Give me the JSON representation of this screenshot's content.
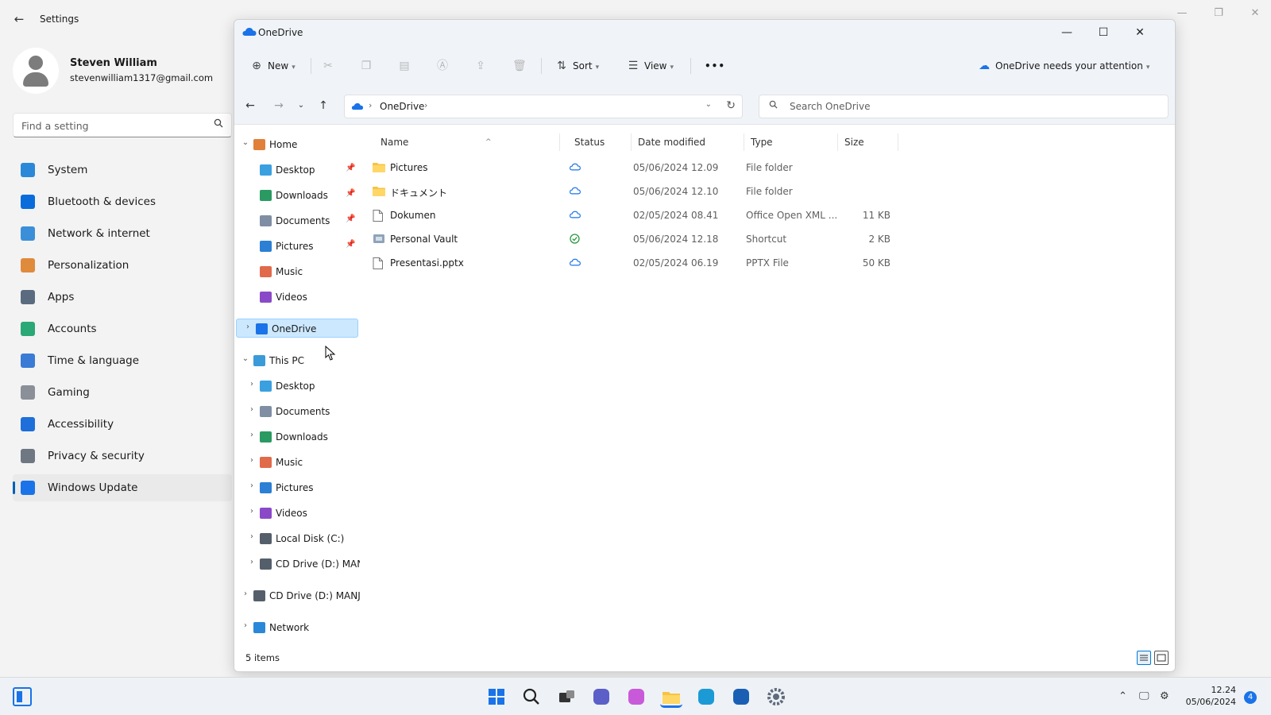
{
  "settings": {
    "title": "Settings",
    "back_glyph": "←",
    "profile": {
      "name": "Steven William",
      "email": "stevenwilliam1317@gmail.com"
    },
    "search_placeholder": "Find a setting",
    "nav": [
      {
        "label": "System",
        "icon": "monitor-icon",
        "color": "#2b88d8"
      },
      {
        "label": "Bluetooth & devices",
        "icon": "bluetooth-icon",
        "color": "#0a6cdb"
      },
      {
        "label": "Network & internet",
        "icon": "wifi-icon",
        "color": "#3b8fd9"
      },
      {
        "label": "Personalization",
        "icon": "brush-icon",
        "color": "#e08a3c"
      },
      {
        "label": "Apps",
        "icon": "apps-icon",
        "color": "#5b6b7f"
      },
      {
        "label": "Accounts",
        "icon": "person-icon",
        "color": "#2aa876"
      },
      {
        "label": "Time & language",
        "icon": "globe-clock-icon",
        "color": "#3a7bd5"
      },
      {
        "label": "Gaming",
        "icon": "controller-icon",
        "color": "#8a8f98"
      },
      {
        "label": "Accessibility",
        "icon": "accessibility-icon",
        "color": "#1e6fd9"
      },
      {
        "label": "Privacy & security",
        "icon": "shield-icon",
        "color": "#6f7782"
      },
      {
        "label": "Windows Update",
        "icon": "sync-icon",
        "color": "#1a73e8"
      }
    ]
  },
  "explorer": {
    "title": "OneDrive",
    "toolbar": {
      "new_label": "New",
      "sort_label": "Sort",
      "view_label": "View",
      "more_label": "•••",
      "attention_label": "OneDrive needs your attention"
    },
    "address": {
      "crumb": "OneDrive"
    },
    "search_placeholder": "Search OneDrive",
    "nav_tree": [
      {
        "label": "Home",
        "expanded": true,
        "level": 0,
        "icon": "home-icon",
        "color": "#e0803a"
      },
      {
        "label": "Desktop",
        "level": 1,
        "pinned": true,
        "icon": "desktop-icon",
        "color": "#3aa0e0"
      },
      {
        "label": "Downloads",
        "level": 1,
        "pinned": true,
        "icon": "download-icon",
        "color": "#2a9a62"
      },
      {
        "label": "Documents",
        "level": 1,
        "pinned": true,
        "icon": "document-icon",
        "color": "#7f8ea3"
      },
      {
        "label": "Pictures",
        "level": 1,
        "pinned": true,
        "icon": "picture-icon",
        "color": "#2b7fd4"
      },
      {
        "label": "Music",
        "level": 1,
        "icon": "music-icon",
        "color": "#e06a4a"
      },
      {
        "label": "Videos",
        "level": 1,
        "icon": "video-icon",
        "color": "#8a4ac8"
      },
      {
        "label": "OneDrive",
        "level": 0,
        "selected": true,
        "icon": "onedrive-icon",
        "color": "#1a73e8"
      },
      {
        "label": "This PC",
        "level": 0,
        "expanded": true,
        "icon": "pc-icon",
        "color": "#3a9bd8"
      },
      {
        "label": "Desktop",
        "level": 1,
        "icon": "desktop-icon",
        "color": "#3aa0e0"
      },
      {
        "label": "Documents",
        "level": 1,
        "icon": "document-icon",
        "color": "#7f8ea3"
      },
      {
        "label": "Downloads",
        "level": 1,
        "icon": "download-icon",
        "color": "#2a9a62"
      },
      {
        "label": "Music",
        "level": 1,
        "icon": "music-icon",
        "color": "#e06a4a"
      },
      {
        "label": "Pictures",
        "level": 1,
        "icon": "picture-icon",
        "color": "#2b7fd4"
      },
      {
        "label": "Videos",
        "level": 1,
        "icon": "video-icon",
        "color": "#8a4ac8"
      },
      {
        "label": "Local Disk (C:)",
        "level": 1,
        "icon": "disk-icon",
        "color": "#555f6b"
      },
      {
        "label": "CD Drive (D:) MAN",
        "level": 1,
        "icon": "cd-drive-icon",
        "color": "#555f6b"
      },
      {
        "label": "CD Drive (D:) MANJ",
        "level": 0,
        "icon": "cd-drive-icon",
        "color": "#555f6b"
      },
      {
        "label": "Network",
        "level": 0,
        "icon": "network-icon",
        "color": "#2b88d8"
      }
    ],
    "columns": {
      "name": "Name",
      "status": "Status",
      "date": "Date modified",
      "type": "Type",
      "size": "Size"
    },
    "files": [
      {
        "name": "Pictures",
        "status": "cloud",
        "date": "05/06/2024 12.09",
        "type": "File folder",
        "size": "",
        "icon": "folder-icon"
      },
      {
        "name": "ドキュメント",
        "status": "cloud",
        "date": "05/06/2024 12.10",
        "type": "File folder",
        "size": "",
        "icon": "folder-icon"
      },
      {
        "name": "Dokumen",
        "status": "cloud",
        "date": "02/05/2024 08.41",
        "type": "Office Open XML ...",
        "size": "11 KB",
        "icon": "document-file-icon"
      },
      {
        "name": "Personal Vault",
        "status": "synced",
        "date": "05/06/2024 12.18",
        "type": "Shortcut",
        "size": "2 KB",
        "icon": "vault-shortcut-icon"
      },
      {
        "name": "Presentasi.pptx",
        "status": "cloud",
        "date": "02/05/2024 06.19",
        "type": "PPTX File",
        "size": "50 KB",
        "icon": "file-icon"
      }
    ],
    "item_count": "5 items"
  },
  "taskbar": {
    "time": "12.24",
    "date": "05/06/2024",
    "notification_count": "4",
    "apps": [
      {
        "icon": "windows-start-icon",
        "color": "#1a73e8"
      },
      {
        "icon": "search-icon",
        "color": "#222222"
      },
      {
        "icon": "task-view-icon",
        "color": "#333333"
      },
      {
        "icon": "meet-icon",
        "color": "#5b5fc7"
      },
      {
        "icon": "copilot-icon",
        "color": "#c85ad9"
      },
      {
        "icon": "file-explorer-icon",
        "color": "#f2b200"
      },
      {
        "icon": "edge-icon",
        "color": "#1c9ad6"
      },
      {
        "icon": "store-icon",
        "color": "#1a5fb4"
      },
      {
        "icon": "settings-gear-icon",
        "color": "#5f6b7a"
      }
    ]
  },
  "colors": {
    "accent": "#005fb8",
    "selection": "#cce8ff",
    "cloud": "#1a73e8",
    "synced": "#2a9a40"
  }
}
